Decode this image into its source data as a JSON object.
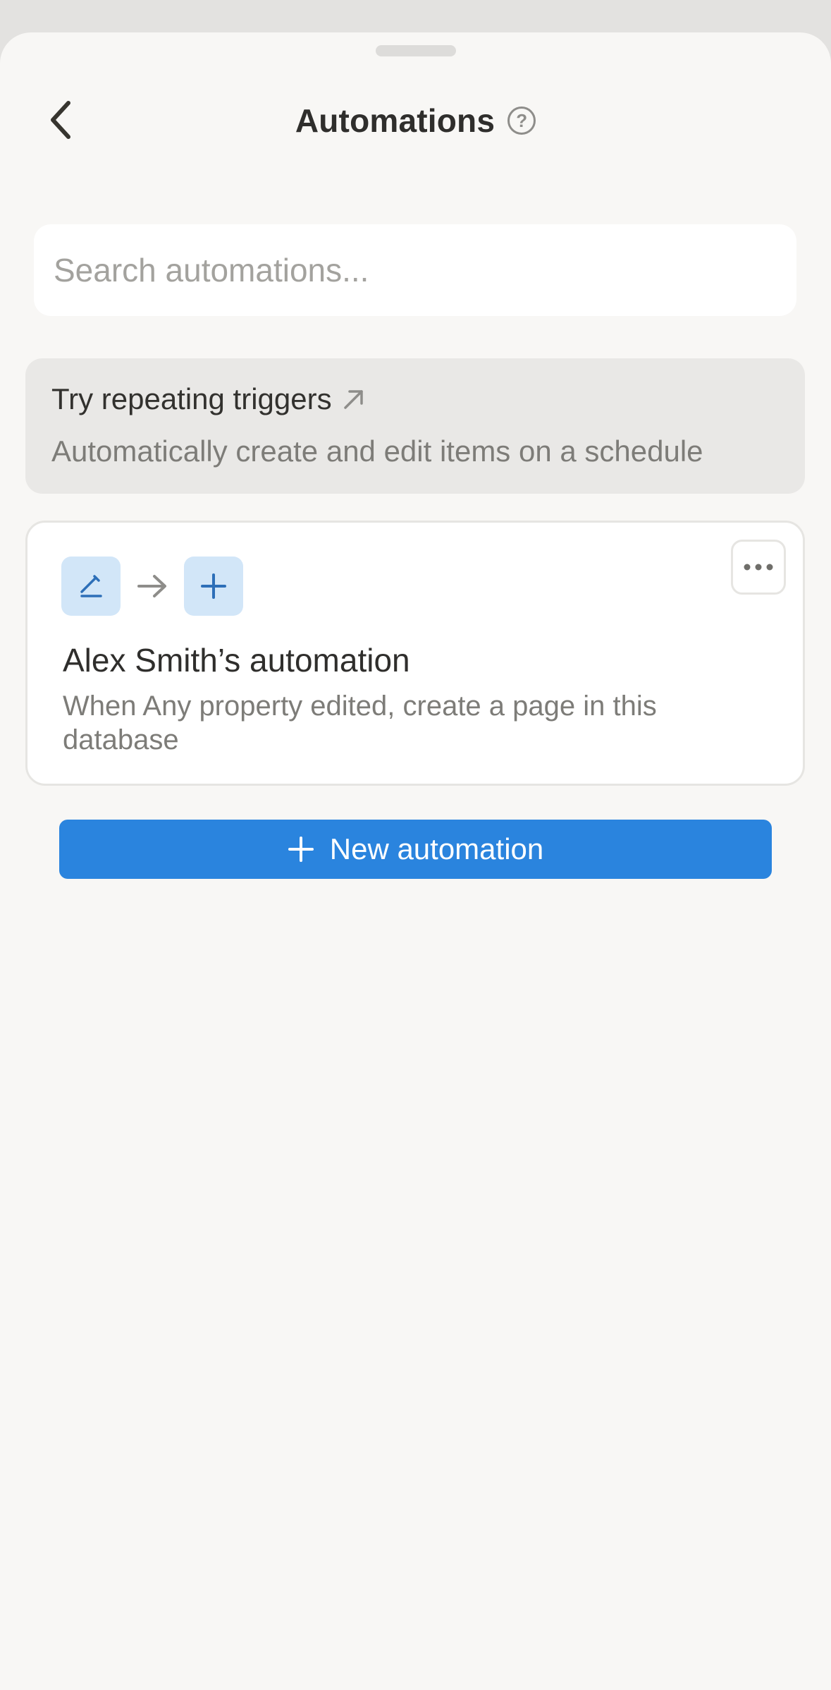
{
  "header": {
    "title": "Automations",
    "help_glyph": "?",
    "back_icon": "chevron-left-icon",
    "help_icon": "question-circle-icon"
  },
  "search": {
    "placeholder": "Search automations...",
    "value": ""
  },
  "promo": {
    "title": "Try repeating triggers",
    "title_icon": "arrow-up-right-icon",
    "subtitle": "Automatically create and edit items on a schedule"
  },
  "automations": [
    {
      "trigger_icon": "pencil-icon",
      "connector_icon": "arrow-right-icon",
      "action_icon": "plus-icon",
      "title": "Alex Smith’s automation",
      "description": "When Any property edited, create a page in this database",
      "menu_icon": "more-horizontal-icon"
    }
  ],
  "actions": {
    "new_automation_label": "New automation",
    "new_automation_icon": "plus-icon"
  },
  "colors": {
    "accent": "#2a84de",
    "icon_tile": "#d2e6f8",
    "icon_blue": "#2d6fb8",
    "background": "#f8f7f5"
  }
}
